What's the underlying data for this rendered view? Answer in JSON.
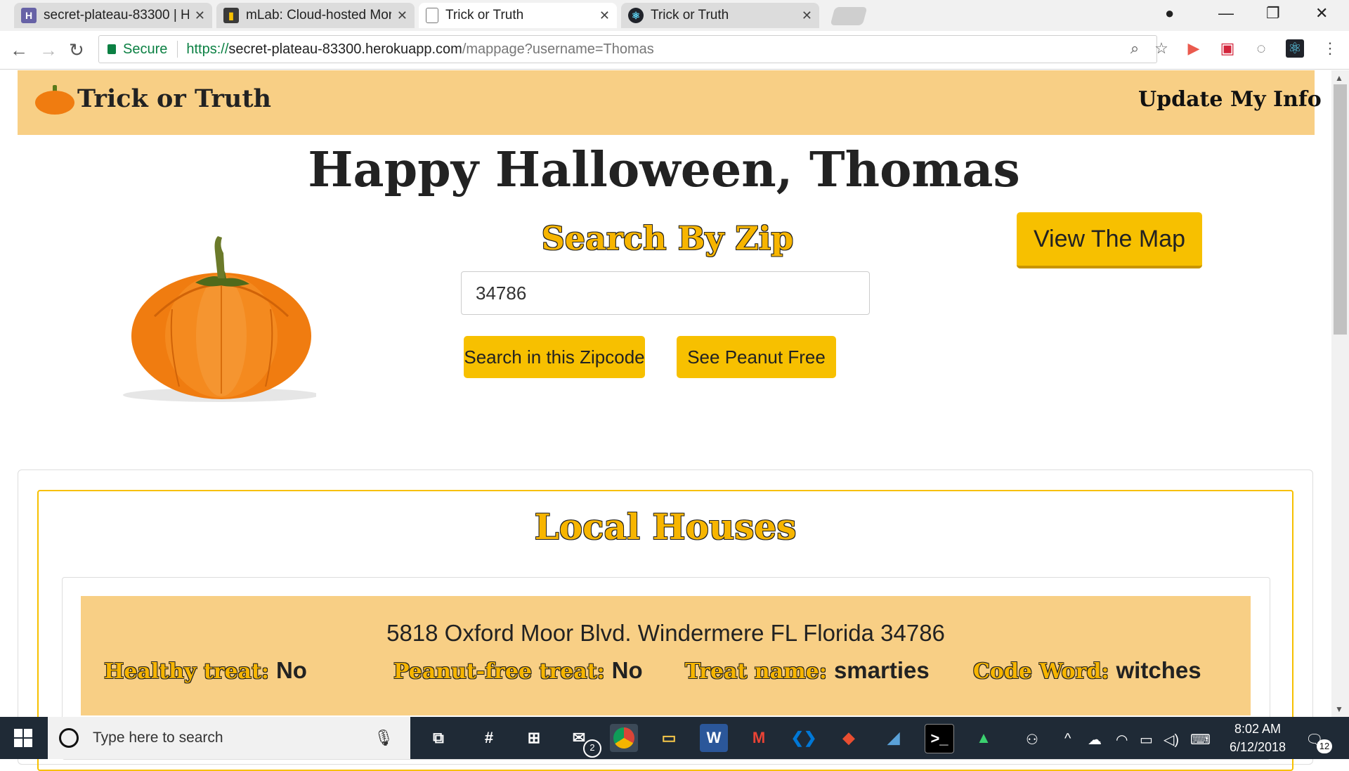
{
  "browser": {
    "tabs": [
      {
        "title": "secret-plateau-83300 | He",
        "icon": "heroku-icon",
        "color": "#6762a6"
      },
      {
        "title": "mLab: Cloud-hosted Mor",
        "icon": "mlab-icon",
        "color": "#3a3a3a"
      },
      {
        "title": "Trick or Truth",
        "icon": "page-icon",
        "color": "#ffffff"
      },
      {
        "title": "Trick or Truth",
        "icon": "react-icon",
        "color": "#20232a"
      }
    ],
    "security_label": "Secure",
    "url_scheme": "https://",
    "url_host": "secret-plateau-83300.herokuapp.com",
    "url_path": "/mappage?username=Thomas"
  },
  "nav": {
    "brand": "Trick or Truth",
    "update_link": "Update My Info"
  },
  "main": {
    "greeting": "Happy Halloween, Thomas",
    "search_title": "Search By Zip",
    "zip_value": "34786",
    "search_button": "Search in this Zipcode",
    "peanut_button": "See Peanut Free",
    "map_button": "View The Map"
  },
  "houses": {
    "title": "Local Houses",
    "items": [
      {
        "address": "5818 Oxford Moor Blvd. Windermere FL Florida 34786",
        "healthy_label": "Healthy treat:",
        "healthy_value": "No",
        "peanut_label": "Peanut-free treat:",
        "peanut_value": "No",
        "treat_label": "Treat name:",
        "treat_value": "smarties",
        "code_label": "Code Word:",
        "code_value": "witches"
      }
    ]
  },
  "taskbar": {
    "search_placeholder": "Type here to search",
    "time": "8:02 AM",
    "date": "6/12/2018",
    "mail_badge": "2",
    "notification_count": "12"
  },
  "colors": {
    "navbar": "#f8cf85",
    "accent": "#f7c000",
    "taskbar": "#1f2a36"
  }
}
